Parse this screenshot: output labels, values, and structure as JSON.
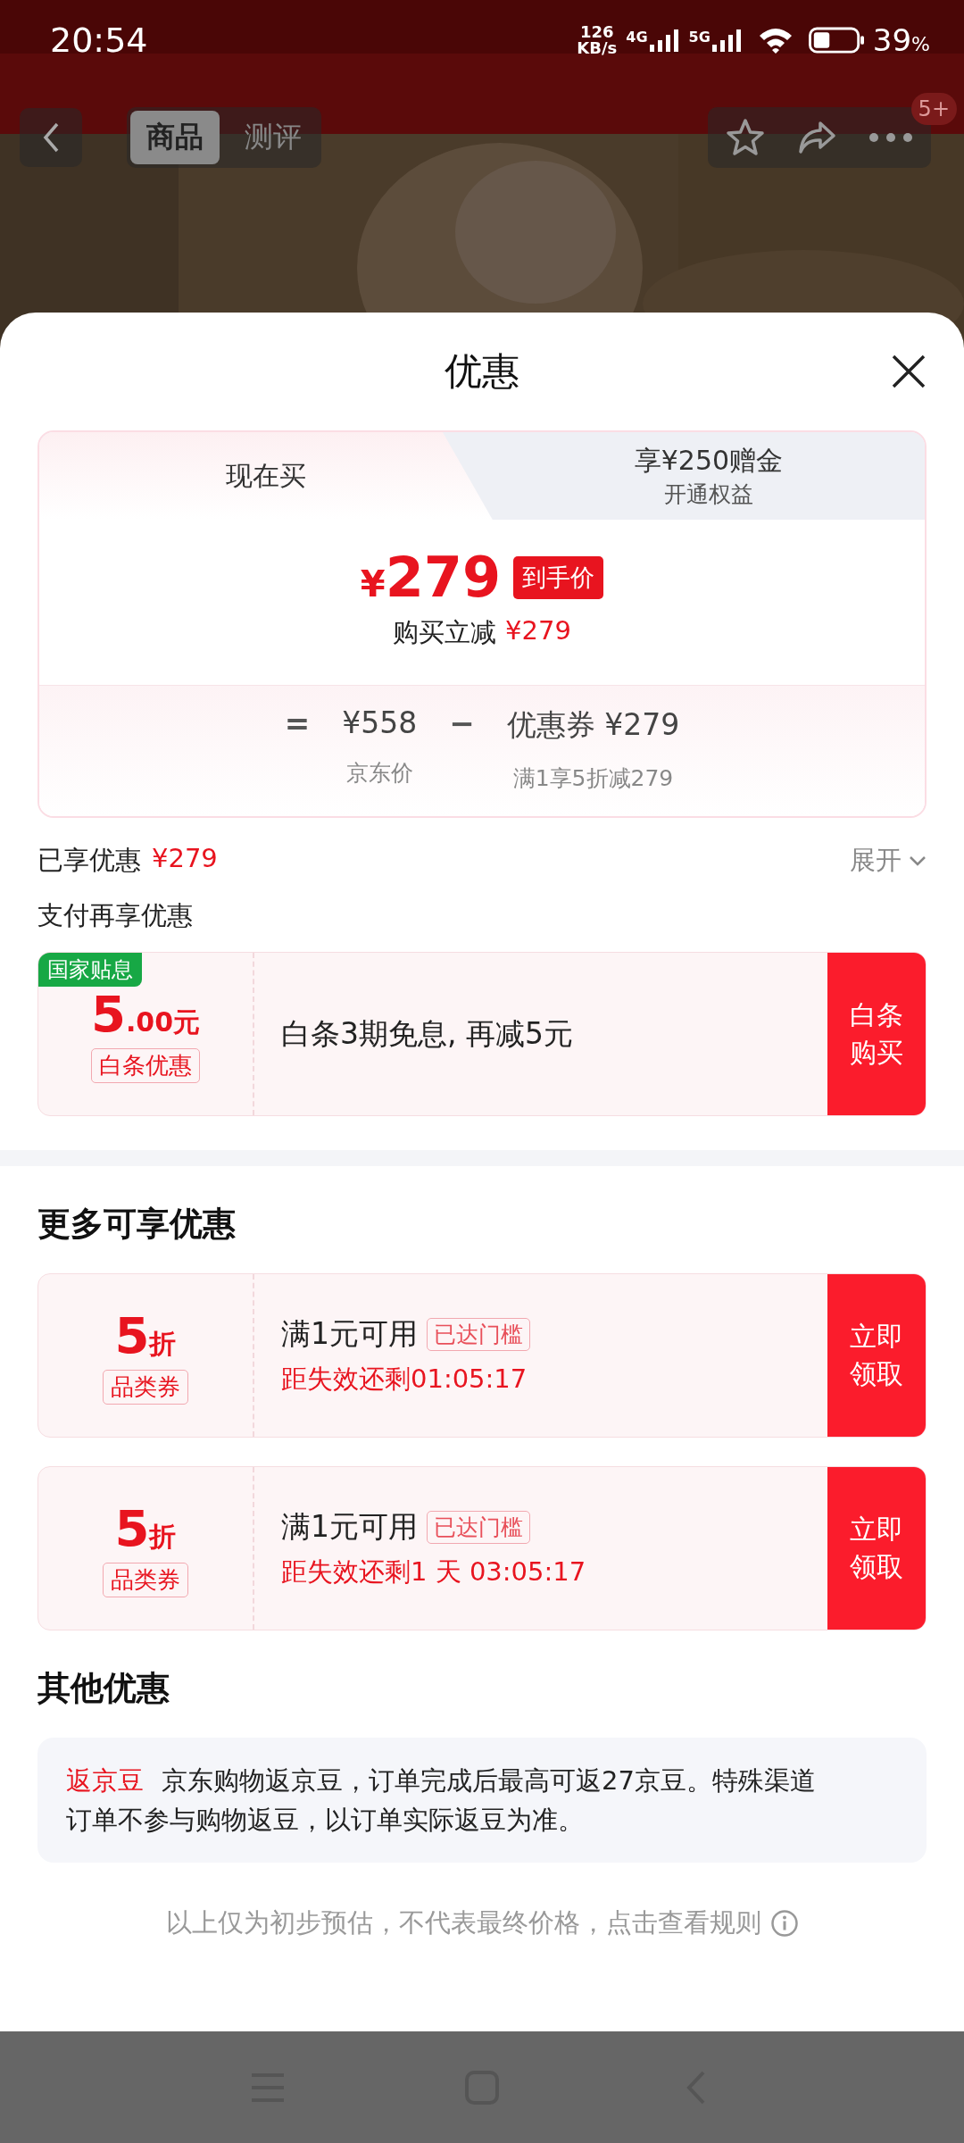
{
  "status_bar": {
    "time": "20:54",
    "net_speed_value": "126",
    "net_speed_unit": "KB/s",
    "networks": [
      "4G",
      "5G"
    ],
    "battery": "39",
    "battery_unit": "%"
  },
  "nav": {
    "tabs": [
      {
        "label": "商品",
        "selected": true
      },
      {
        "label": "测评",
        "selected": false
      }
    ],
    "badge": "5+"
  },
  "sheet": {
    "title": "优惠"
  },
  "price_tabs": [
    {
      "label": "现在买",
      "selected": true
    },
    {
      "label": "享¥250赠金",
      "sublabel": "开通权益",
      "selected": false
    }
  ],
  "price": {
    "currency": "¥",
    "amount": "279",
    "tag": "到手价",
    "saving_label": "购买立减",
    "saving": "¥279",
    "formula": [
      {
        "kind": "operator",
        "text": "="
      },
      {
        "kind": "term",
        "value": "¥558",
        "caption": "京东价"
      },
      {
        "kind": "operator",
        "text": "−"
      },
      {
        "kind": "term",
        "value": "优惠券 ¥279",
        "caption": "满1享5折减279"
      }
    ]
  },
  "enjoyed": {
    "label": "已享优惠",
    "amount": "¥279",
    "expand": "展开"
  },
  "pay_section": {
    "title": "支付再享优惠",
    "coupons": [
      {
        "kind": "subsidy",
        "flag": "国家贴息",
        "value": "5",
        "value_unit": ".00元",
        "tag": "白条优惠",
        "text": "白条3期免息, 再减5元",
        "button": "白条购买"
      }
    ]
  },
  "more_section": {
    "title": "更多可享优惠",
    "coupons": [
      {
        "kind": "discount",
        "value": "5",
        "value_unit": "折",
        "tag": "品类券",
        "condition": "满1元可用",
        "status": "已达门槛",
        "countdown": "距失效还剩01:05:17",
        "button": "立即领取"
      },
      {
        "kind": "discount",
        "value": "5",
        "value_unit": "折",
        "tag": "品类券",
        "condition": "满1元可用",
        "status": "已达门槛",
        "countdown": "距失效还剩1 天 03:05:17",
        "button": "立即领取"
      }
    ]
  },
  "other_section": {
    "title": "其他优惠",
    "items": [
      {
        "tag": "返京豆",
        "text": "京东购物返京豆，订单完成后最高可返27京豆。特殊渠道订单不参与购物返豆，以订单实际返豆为准。"
      }
    ]
  },
  "footnote": "以上仅为初步预估，不代表最终价格，点击查看规则"
}
